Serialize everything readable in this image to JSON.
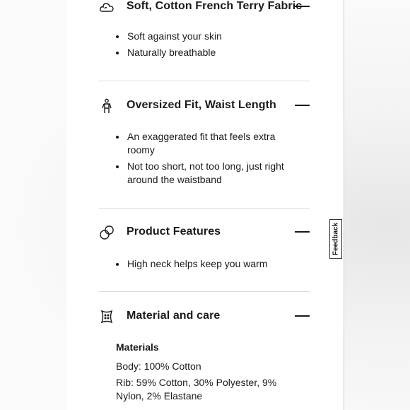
{
  "sections": [
    {
      "title": "Soft, Cotton French Terry Fabric",
      "icon": "cloud-icon",
      "bullets": [
        "Soft against your skin",
        "Naturally breathable"
      ]
    },
    {
      "title": "Oversized Fit, Waist Length",
      "icon": "person-fit-icon",
      "bullets": [
        "An exaggerated fit that feels extra roomy",
        "Not too short, not too long, just right around the waistband"
      ]
    },
    {
      "title": "Product Features",
      "icon": "features-icon",
      "bullets": [
        "High neck helps keep you warm"
      ]
    },
    {
      "title": "Material and care",
      "icon": "fabric-swatch-icon"
    }
  ],
  "materials": {
    "heading": "Materials",
    "body": "Body: 100% Cotton",
    "rib": "Rib: 59% Cotton, 30% Polyester, 9% Nylon, 2% Elastane"
  },
  "feedback_label": "Feedback"
}
